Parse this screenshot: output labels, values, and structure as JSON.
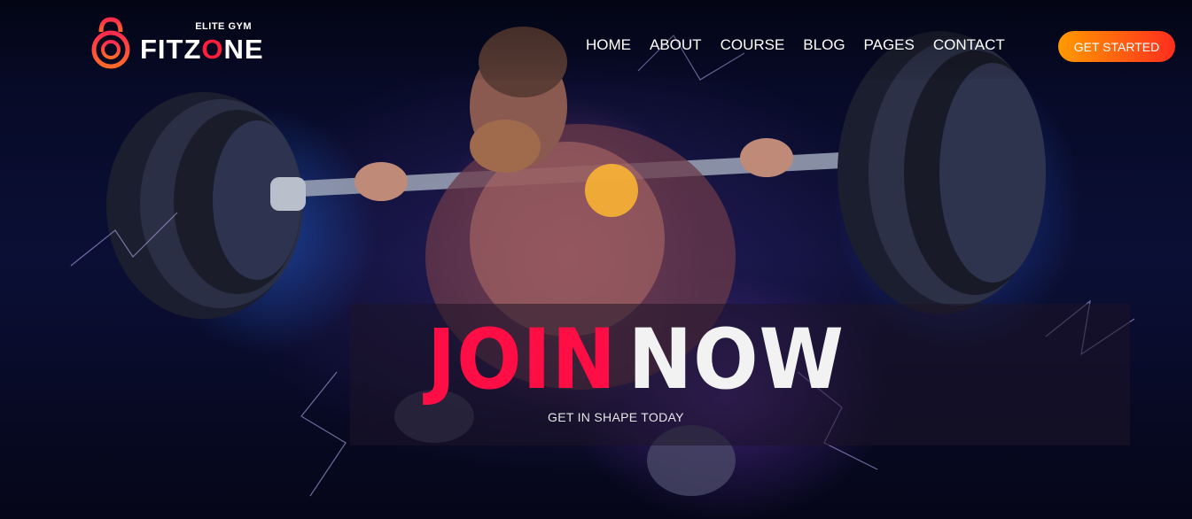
{
  "brand": {
    "tagline": "ELITE GYM",
    "name_prefix": "FITZ",
    "name_accent": "O",
    "name_suffix": "NE",
    "accent_color": "#ff1e3c"
  },
  "nav": {
    "items": [
      "HOME",
      "ABOUT",
      "COURSE",
      "BLOG",
      "PAGES",
      "CONTACT"
    ]
  },
  "cta": {
    "label": "GET STARTED",
    "gradient": [
      "#ff9a00",
      "#ff2d1e"
    ]
  },
  "hero": {
    "headline_word1": "JOIN",
    "headline_word2": "NOW",
    "headline_word1_color": "#ff0d45",
    "subtitle": "GET IN SHAPE TODAY"
  }
}
